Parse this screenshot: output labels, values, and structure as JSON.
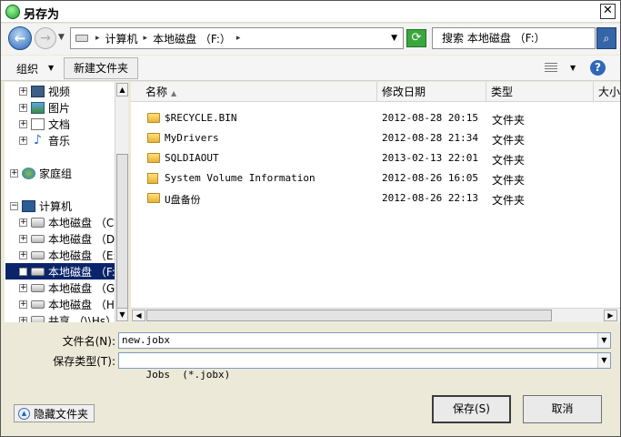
{
  "window": {
    "title": "另存为",
    "close_glyph": "✕"
  },
  "address": {
    "crumbs": [
      "计算机",
      "本地磁盘 （F:）"
    ],
    "search_placeholder": "搜索 本地磁盘 （F:）"
  },
  "toolbar": {
    "organize": "组织",
    "new_folder": "新建文件夹",
    "help": "?"
  },
  "tree": {
    "items": [
      {
        "label": "视频",
        "icon": "video-icon"
      },
      {
        "label": "图片",
        "icon": "pictures-icon"
      },
      {
        "label": "文档",
        "icon": "documents-icon"
      },
      {
        "label": "音乐",
        "icon": "music-icon"
      },
      {
        "label": "家庭组",
        "icon": "homegroup-icon"
      },
      {
        "label": "计算机",
        "icon": "computer-icon"
      },
      {
        "label": "本地磁盘 （C:",
        "icon": "system-drive-icon"
      },
      {
        "label": "本地磁盘 （D:",
        "icon": "drive-icon"
      },
      {
        "label": "本地磁盘 （E:",
        "icon": "drive-icon"
      },
      {
        "label": "本地磁盘 （F:",
        "icon": "drive-icon"
      },
      {
        "label": "本地磁盘 （G:",
        "icon": "drive-icon"
      },
      {
        "label": "本地磁盘 （H:",
        "icon": "drive-icon"
      },
      {
        "label": "共享 （\\\\Hs）",
        "icon": "network-drive-icon"
      }
    ]
  },
  "columns": {
    "name": "名称",
    "modified": "修改日期",
    "type": "类型",
    "size": "大小"
  },
  "files": [
    {
      "name": "$RECYCLE.BIN",
      "modified": "2012-08-28 20:15",
      "type": "文件夹",
      "icon": "folder-icon"
    },
    {
      "name": "MyDrivers",
      "modified": "2012-08-28 21:34",
      "type": "文件夹",
      "icon": "folder-icon"
    },
    {
      "name": "SQLDIAOUT",
      "modified": "2013-02-13 22:01",
      "type": "文件夹",
      "icon": "folder-icon"
    },
    {
      "name": "System Volume Information",
      "modified": "2012-08-26 16:05",
      "type": "文件夹",
      "icon": "locked-folder-icon"
    },
    {
      "name": "U盘备份",
      "modified": "2012-08-26 22:13",
      "type": "文件夹",
      "icon": "folder-icon"
    }
  ],
  "form": {
    "filename_label": "文件名(N):",
    "filename_value": "new.jobx",
    "filetype_label": "保存类型(T):",
    "filetype_value": "Jobs  (*.jobx)"
  },
  "buttons": {
    "hide_folders": "隐藏文件夹",
    "save": "保存(S)",
    "cancel": "取消"
  }
}
